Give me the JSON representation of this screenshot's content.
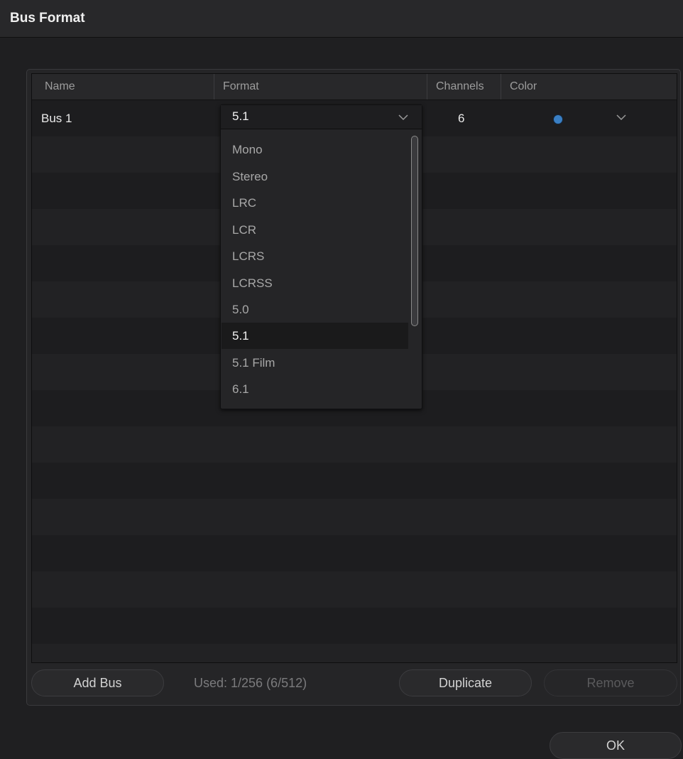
{
  "window": {
    "title": "Bus Format"
  },
  "table": {
    "columns": [
      "Name",
      "Format",
      "Channels",
      "Color"
    ],
    "rows": [
      {
        "name": "Bus 1",
        "format": "5.1",
        "channels": "6",
        "color": "#3a7fc4"
      }
    ]
  },
  "format_dropdown": {
    "selected": "5.1",
    "options": [
      "Mono",
      "Stereo",
      "LRC",
      "LCR",
      "LCRS",
      "LCRSS",
      "5.0",
      "5.1",
      "5.1 Film",
      "6.1"
    ]
  },
  "footer": {
    "add_bus": "Add Bus",
    "used": "Used: 1/256  (6/512)",
    "duplicate": "Duplicate",
    "remove": "Remove"
  },
  "ok_button": "OK",
  "colors": {
    "background": "#1f1f21",
    "panel": "#252527",
    "bus_color": "#3a7fc4"
  }
}
